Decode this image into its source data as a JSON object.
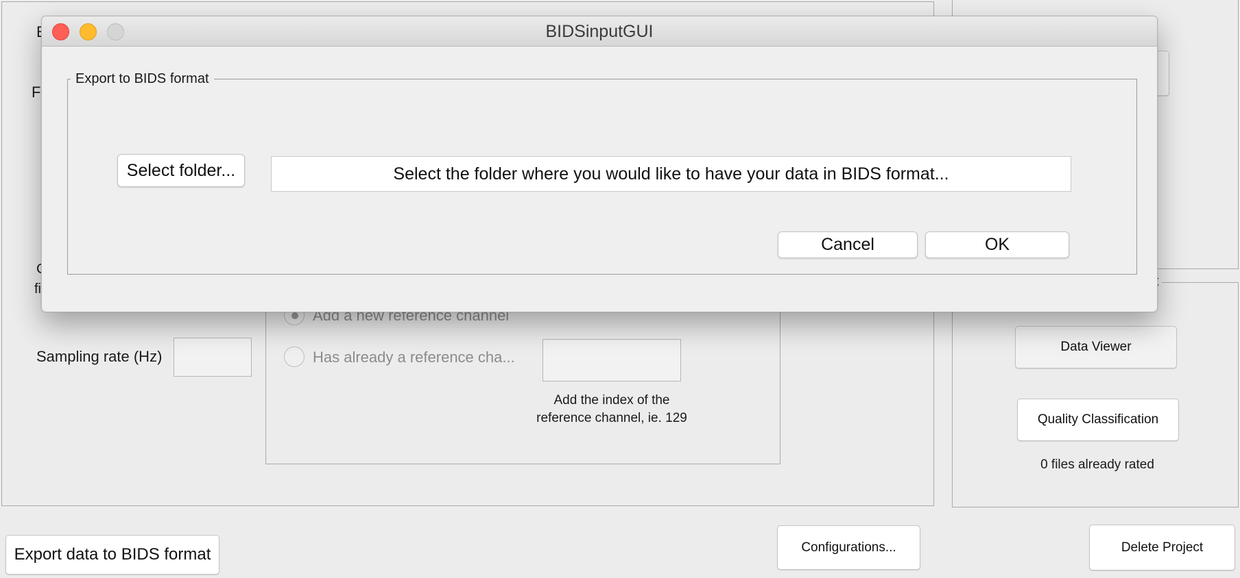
{
  "background": {
    "sampling_rate_label": "Sampling rate (Hz)",
    "reference": {
      "add_new_option": "Add a new reference channel",
      "has_reference_option": "Has already a reference cha...",
      "index_hint_line1": "Add the index of the",
      "index_hint_line2": "reference channel, ie. 129"
    },
    "right_panel": {
      "data_viewer_button": "Data Viewer",
      "quality_classification_button": "Quality Classification",
      "files_rated_text": "0 files already rated"
    },
    "footer": {
      "export_bids_button": "Export data to BIDS format",
      "configurations_button": "Configurations...",
      "delete_project_button": "Delete Project"
    },
    "partial_letters": {
      "a": "E",
      "b": "F",
      "c": "C",
      "d": "fi",
      "e": "t"
    }
  },
  "dialog": {
    "window_title": "BIDSinputGUI",
    "group_title": "Export to BIDS format",
    "select_folder_button": "Select folder...",
    "folder_path_text": "Select the folder where you would like to have your data in BIDS format...",
    "cancel_button": "Cancel",
    "ok_button": "OK"
  },
  "colors": {
    "close_light": "#fe5f57",
    "minimize_light": "#febb2e",
    "zoom_light_inactive": "#d5d5d5"
  }
}
